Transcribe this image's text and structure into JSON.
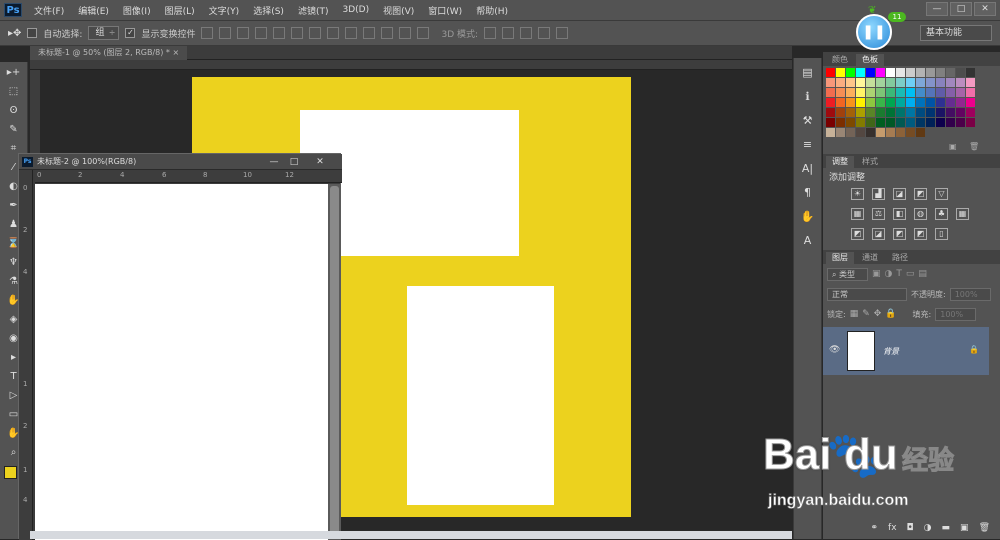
{
  "app": {
    "logo": "Ps"
  },
  "menu": [
    "文件(F)",
    "编辑(E)",
    "图像(I)",
    "图层(L)",
    "文字(Y)",
    "选择(S)",
    "滤镜(T)",
    "3D(D)",
    "视图(V)",
    "窗口(W)",
    "帮助(H)"
  ],
  "window_controls": {
    "minimize": "—",
    "restore": "□",
    "close": "✕"
  },
  "options": {
    "auto_select_label": "自动选择:",
    "auto_select_checked": false,
    "auto_select_target": "组",
    "transform_label": "显示变换控件",
    "transform_checked": true,
    "mode_3d_label": "3D 模式:",
    "workspace": "基本功能"
  },
  "floating_widget": {
    "badge": "11"
  },
  "document": {
    "tab_label": "未标题-1 @ 50% (图层 2, RGB/8) *",
    "tab_close": "×",
    "canvas_color": "#ecd21e"
  },
  "floating_window": {
    "title": "未标题-2 @ 100%(RGB/8)",
    "ruler_top": [
      "0",
      "2",
      "4",
      "6",
      "8",
      "10",
      "12"
    ],
    "ruler_left": [
      "0",
      "2",
      "4",
      "1",
      "2",
      "1",
      "4"
    ]
  },
  "tools": [
    "▸+",
    "⬚",
    "ʘ",
    "✎",
    "⌗",
    "⁄",
    "◐",
    "✒",
    "♟",
    "⌛",
    "♆",
    "⚗",
    "✋",
    "◈",
    "◉",
    "▸",
    "T",
    "▷",
    "▭",
    "✋",
    "⌕"
  ],
  "foreground_color": "#ecd21e",
  "background_color": "#ffffff",
  "panels": {
    "color_tabs": [
      "颜色",
      "色板"
    ],
    "adjust_tabs": [
      "调整",
      "样式"
    ],
    "adjust_title": "添加调整",
    "layers_tabs": [
      "图层",
      "通道",
      "路径"
    ],
    "filter_kind": "类型",
    "blend_mode": "正常",
    "opacity_label": "不透明度:",
    "opacity_value": "100%",
    "lock_label": "锁定:",
    "fill_label": "填充:",
    "fill_value": "100%",
    "layer_name": "背景"
  },
  "swatch_colors": [
    "#ff0000",
    "#ffff00",
    "#00ff00",
    "#00ffff",
    "#0000ff",
    "#ff00ff",
    "#ffffff",
    "#e6e6e6",
    "#cccccc",
    "#b3b3b3",
    "#999999",
    "#808080",
    "#666666",
    "#4d4d4d",
    "#333333",
    "#f7977a",
    "#f9ad81",
    "#fdc68a",
    "#fff79a",
    "#c4df9b",
    "#a2d39c",
    "#82ca9d",
    "#7bcdc8",
    "#6ecff6",
    "#7ea7d8",
    "#8493ca",
    "#8882be",
    "#a187be",
    "#bc8dbf",
    "#f49ac2",
    "#f26c4f",
    "#f68e55",
    "#fbaf5c",
    "#fff467",
    "#acd372",
    "#7cc576",
    "#3bb878",
    "#1abbb4",
    "#00bff3",
    "#438cca",
    "#5574b9",
    "#605ca8",
    "#855fa8",
    "#a763a8",
    "#f06ea9",
    "#ed1c24",
    "#f26522",
    "#f7941d",
    "#fff200",
    "#8dc73f",
    "#39b54a",
    "#00a651",
    "#00a99d",
    "#00aeef",
    "#0072bc",
    "#0054a6",
    "#2e3192",
    "#662d91",
    "#92278f",
    "#ec008c",
    "#9e0b0f",
    "#a0410d",
    "#a36209",
    "#aba000",
    "#598527",
    "#1a7b30",
    "#007236",
    "#00746b",
    "#0076a3",
    "#004b80",
    "#003471",
    "#1b1464",
    "#440e62",
    "#630460",
    "#9e005d",
    "#790000",
    "#7b2e00",
    "#7d4900",
    "#827b00",
    "#406618",
    "#005e20",
    "#005826",
    "#005952",
    "#005b7f",
    "#003663",
    "#002157",
    "#0d004c",
    "#32004b",
    "#4b0049",
    "#7b0046",
    "#c7b299",
    "#998675",
    "#736357",
    "#534741",
    "#37302d",
    "#c69c6d",
    "#a67c52",
    "#8c6239",
    "#754c24",
    "#603913"
  ],
  "side_icons": [
    "▤",
    "ℹ",
    "⚒",
    "≡",
    "A|",
    "¶",
    "✋",
    "A"
  ],
  "adjust_icons_row1": [
    "☀",
    "▟",
    "◪",
    "◩",
    "▽"
  ],
  "adjust_icons_row2": [
    "▦",
    "⚖",
    "◧",
    "◍",
    "♣",
    "▦"
  ],
  "adjust_icons_row3": [
    "◩",
    "◪",
    "◩",
    "◩",
    "▯"
  ],
  "footer_icons": [
    "⚭",
    "fx",
    "◘",
    "◑",
    "▬",
    "▣",
    "🗑"
  ],
  "watermark": {
    "brand": "Bai",
    "brand2": "du",
    "cn": "经验",
    "url": "jingyan.baidu.com"
  }
}
